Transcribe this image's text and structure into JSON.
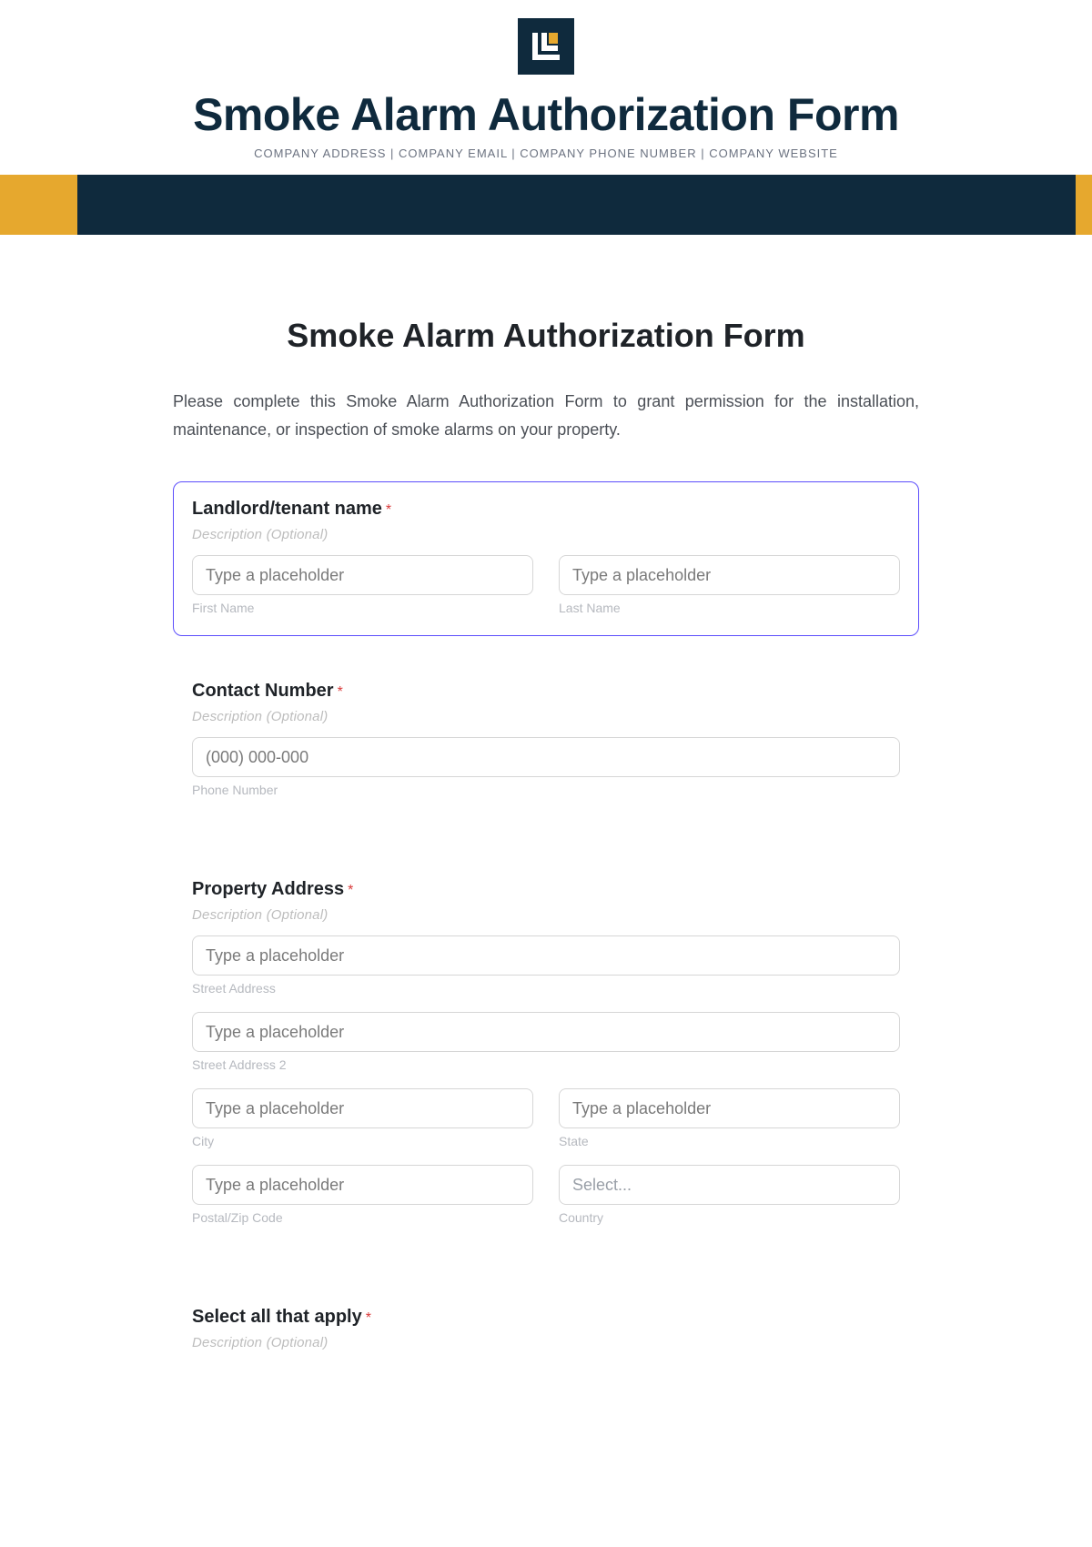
{
  "header": {
    "title": "Smoke Alarm Authorization Form",
    "sub": "COMPANY ADDRESS | COMPANY EMAIL | COMPANY PHONE NUMBER | COMPANY WEBSITE"
  },
  "form": {
    "title": "Smoke Alarm Authorization Form",
    "intro": "Please complete this Smoke Alarm Authorization Form to grant permission for the installation, maintenance, or inspection of smoke alarms on your property."
  },
  "common": {
    "desc_placeholder": "Description (Optional)",
    "input_placeholder": "Type a placeholder",
    "required_mark": "*"
  },
  "sections": {
    "name": {
      "label": "Landlord/tenant name",
      "first_sub": "First Name",
      "last_sub": "Last Name"
    },
    "contact": {
      "label": "Contact Number",
      "phone_placeholder": "(000) 000-000",
      "phone_sub": "Phone Number"
    },
    "address": {
      "label": "Property Address",
      "street_sub": "Street Address",
      "street2_sub": "Street Address 2",
      "city_sub": "City",
      "state_sub": "State",
      "postal_sub": "Postal/Zip Code",
      "country_sub": "Country",
      "country_placeholder": "Select..."
    },
    "select_apply": {
      "label": "Select all that apply"
    }
  }
}
